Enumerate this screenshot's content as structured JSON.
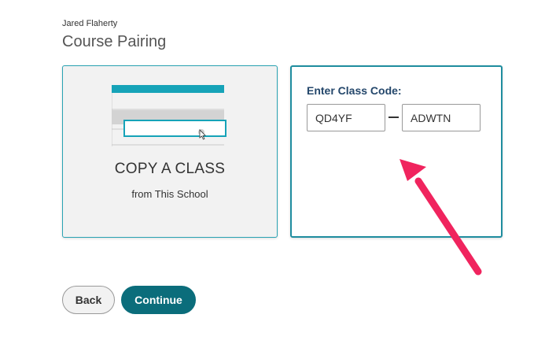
{
  "header": {
    "user_name": "Jared Flaherty",
    "page_title": "Course Pairing"
  },
  "copy_card": {
    "title": "COPY A CLASS",
    "subtitle": "from This School",
    "illustration_icon": "class-list-cursor-icon"
  },
  "code_card": {
    "label": "Enter Class Code:",
    "code_part_1": "QD4YF",
    "code_part_2": "ADWTN",
    "separator": "—"
  },
  "annotation": {
    "arrow_icon": "arrow-icon",
    "arrow_color": "#f0245e"
  },
  "footer": {
    "back_label": "Back",
    "continue_label": "Continue"
  },
  "colors": {
    "accent": "#0b6d7b",
    "teal_border": "#1f8d9f",
    "label_navy": "#24476b"
  }
}
